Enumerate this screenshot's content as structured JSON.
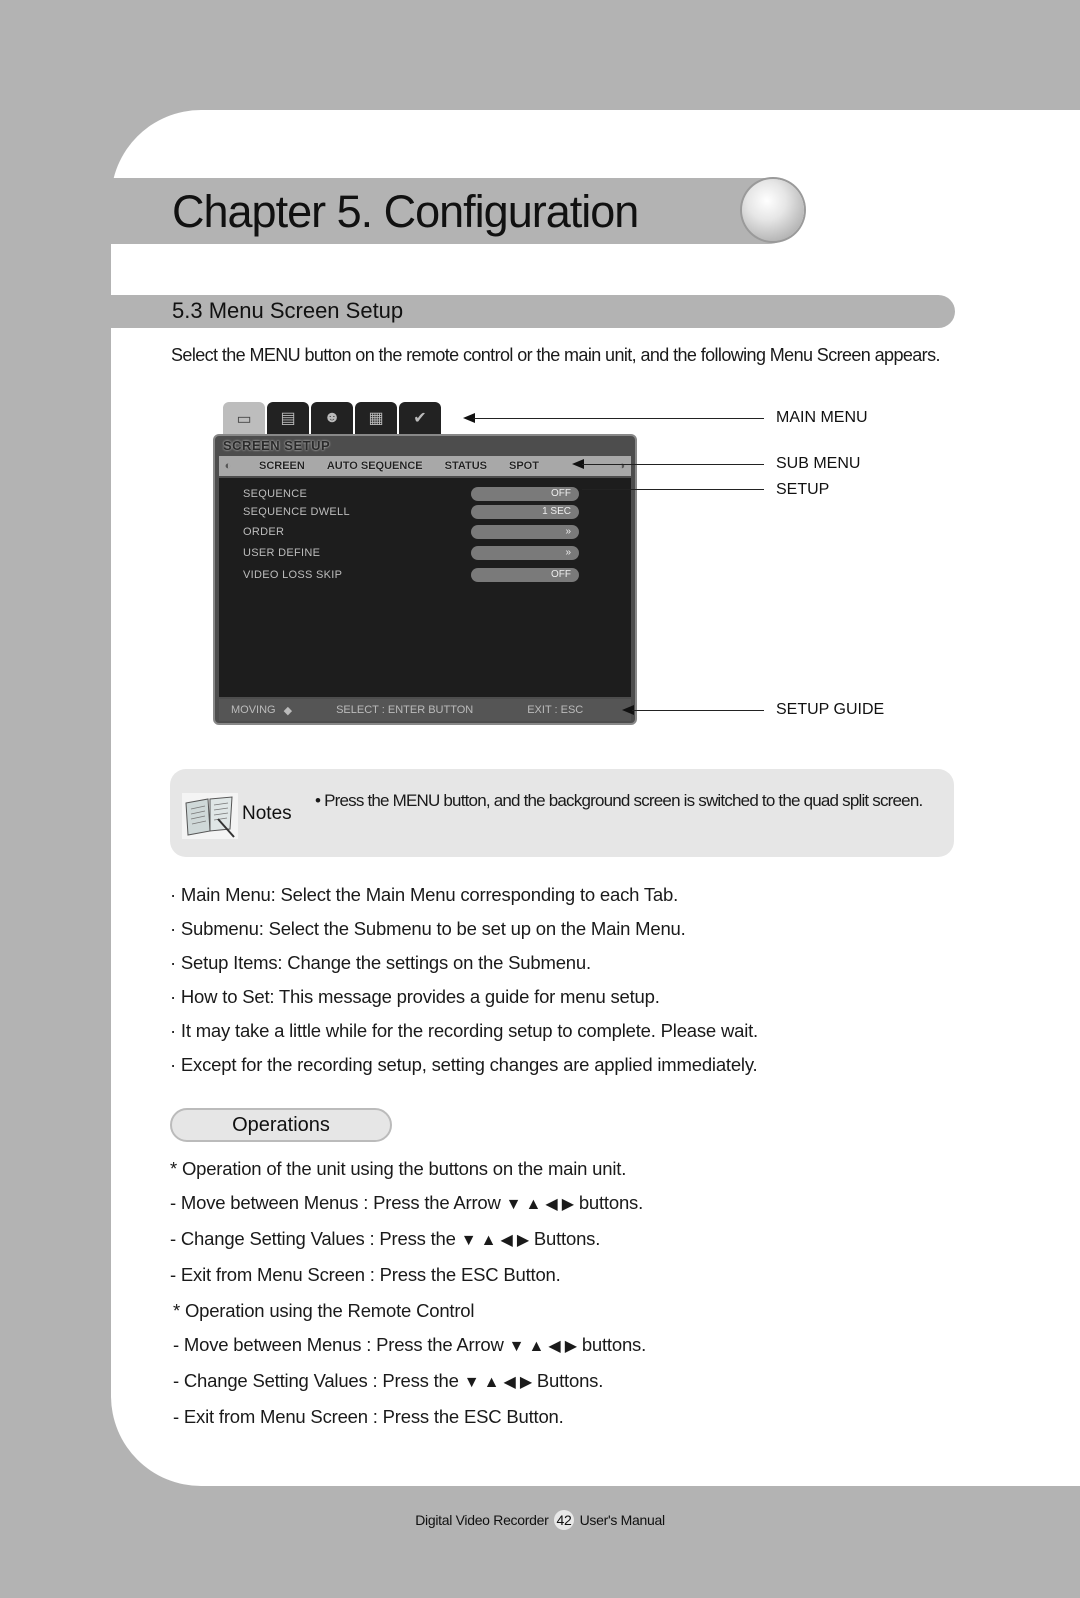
{
  "chapter": {
    "title": "Chapter 5. Configuration"
  },
  "section": {
    "title": "5.3 Menu Screen Setup"
  },
  "intro": "Select the MENU button on the remote control or the main unit, and the following Menu Screen appears.",
  "dvr_screen": {
    "main_tabs": [
      {
        "icon": "monitor-icon",
        "glyph": "▭",
        "active": true
      },
      {
        "icon": "recorder-icon",
        "glyph": "▤",
        "active": false
      },
      {
        "icon": "user-icon",
        "glyph": "☻",
        "active": false
      },
      {
        "icon": "network-icon",
        "glyph": "▦",
        "active": false
      },
      {
        "icon": "checklist-icon",
        "glyph": "✔",
        "active": false
      }
    ],
    "title": "SCREEN SETUP",
    "submenu": {
      "prev_glyph": "◐",
      "next_glyph": "◑",
      "items": [
        "SCREEN",
        "AUTO SEQUENCE",
        "STATUS",
        "SPOT"
      ]
    },
    "settings": [
      {
        "label": "SEQUENCE",
        "value": "OFF"
      },
      {
        "label": "SEQUENCE DWELL",
        "value": "1 SEC"
      },
      {
        "label": "ORDER",
        "value": "»"
      },
      {
        "label": "USER DEFINE",
        "value": "»"
      },
      {
        "label": "VIDEO LOSS SKIP",
        "value": "OFF"
      }
    ],
    "guide": {
      "moving": "MOVING",
      "moving_glyph": "◆",
      "select": "SELECT : ENTER BUTTON",
      "exit": "EXIT : ESC"
    }
  },
  "callouts": {
    "main_menu": "MAIN MENU",
    "sub_menu": "SUB MENU",
    "setup": "SETUP",
    "setup_guide": "SETUP GUIDE"
  },
  "notes": {
    "label": "Notes",
    "text": "• Press the MENU button, and the background screen is switched to the quad split screen."
  },
  "bullets": [
    "· Main Menu: Select the Main Menu corresponding to each Tab.",
    "· Submenu: Select the Submenu to be set up on the Main Menu.",
    "· Setup Items: Change the settings on the Submenu.",
    "· How to Set: This message provides a guide for menu setup.",
    "· It may take a little while for the recording setup to complete. Please wait.",
    "· Except for the recording setup, setting changes are applied immediately."
  ],
  "operations": {
    "heading": "Operations",
    "arrows": "▼ ▲ ◀ ▶",
    "unit": {
      "title": "* Operation of the unit using the buttons on the main unit.",
      "move_prefix": "- Move between Menus : Press the Arrow",
      "move_suffix": "buttons.",
      "change_prefix": "- Change Setting Values : Press the",
      "change_suffix": "Buttons.",
      "exit": "- Exit from Menu Screen : Press the ESC Button."
    },
    "remote": {
      "title": "* Operation using the Remote Control",
      "move_prefix": "- Move between Menus : Press the Arrow",
      "move_suffix": "buttons.",
      "change_prefix": "- Change Setting Values : Press the",
      "change_suffix": "Buttons.",
      "exit": "- Exit from Menu Screen : Press the ESC Button."
    }
  },
  "footer": {
    "left": "Digital Video Recorder",
    "page": "42",
    "right": "User's Manual"
  }
}
